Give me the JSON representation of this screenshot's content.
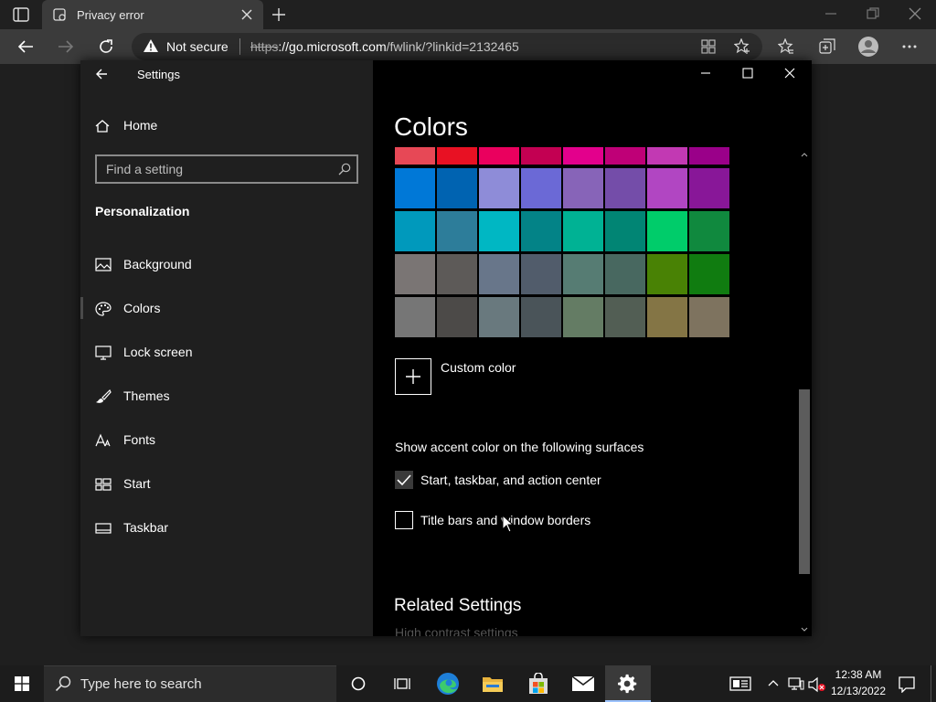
{
  "browser": {
    "tab_title": "Privacy error",
    "not_secure_label": "Not secure",
    "url_scheme": "https",
    "url_host": "://go.microsoft.com",
    "url_path": "/fwlink/?linkid=2132465"
  },
  "settings": {
    "window_title": "Settings",
    "home_label": "Home",
    "search_placeholder": "Find a setting",
    "section_label": "Personalization",
    "nav": [
      {
        "label": "Background",
        "icon": "picture-icon"
      },
      {
        "label": "Colors",
        "icon": "palette-icon",
        "selected": true
      },
      {
        "label": "Lock screen",
        "icon": "monitor-icon"
      },
      {
        "label": "Themes",
        "icon": "brush-icon"
      },
      {
        "label": "Fonts",
        "icon": "font-icon"
      },
      {
        "label": "Start",
        "icon": "start-grid-icon"
      },
      {
        "label": "Taskbar",
        "icon": "taskbar-icon"
      }
    ],
    "page_title": "Colors",
    "custom_color_label": "Custom color",
    "accent_surfaces_label": "Show accent color on the following surfaces",
    "checkbox_start": {
      "label": "Start, taskbar, and action center",
      "checked": true
    },
    "checkbox_titlebars": {
      "label": "Title bars and window borders",
      "checked": false
    },
    "related_settings_title": "Related Settings",
    "high_contrast_link": "High contrast settings",
    "swatches": [
      [
        "#e74856",
        "#e81123",
        "#ea005e",
        "#c30052",
        "#e3008c",
        "#bf0077",
        "#c239b3",
        "#9a0089"
      ],
      [
        "#0078d7",
        "#0063b1",
        "#8e8cd8",
        "#6b69d6",
        "#8764b8",
        "#744da9",
        "#b146c2",
        "#881798"
      ],
      [
        "#0099bc",
        "#2d7d9a",
        "#00b7c3",
        "#038387",
        "#00b294",
        "#018574",
        "#00cc6a",
        "#10893e"
      ],
      [
        "#7a7574",
        "#5d5a58",
        "#68768a",
        "#515c6b",
        "#567c73",
        "#486860",
        "#498205",
        "#107c10"
      ],
      [
        "#767676",
        "#4c4a48",
        "#69797e",
        "#4a5459",
        "#647c64",
        "#525e54",
        "#847545",
        "#7e735f"
      ]
    ]
  },
  "taskbar": {
    "search_placeholder": "Type here to search",
    "time": "12:38 AM",
    "date": "12/13/2022"
  }
}
